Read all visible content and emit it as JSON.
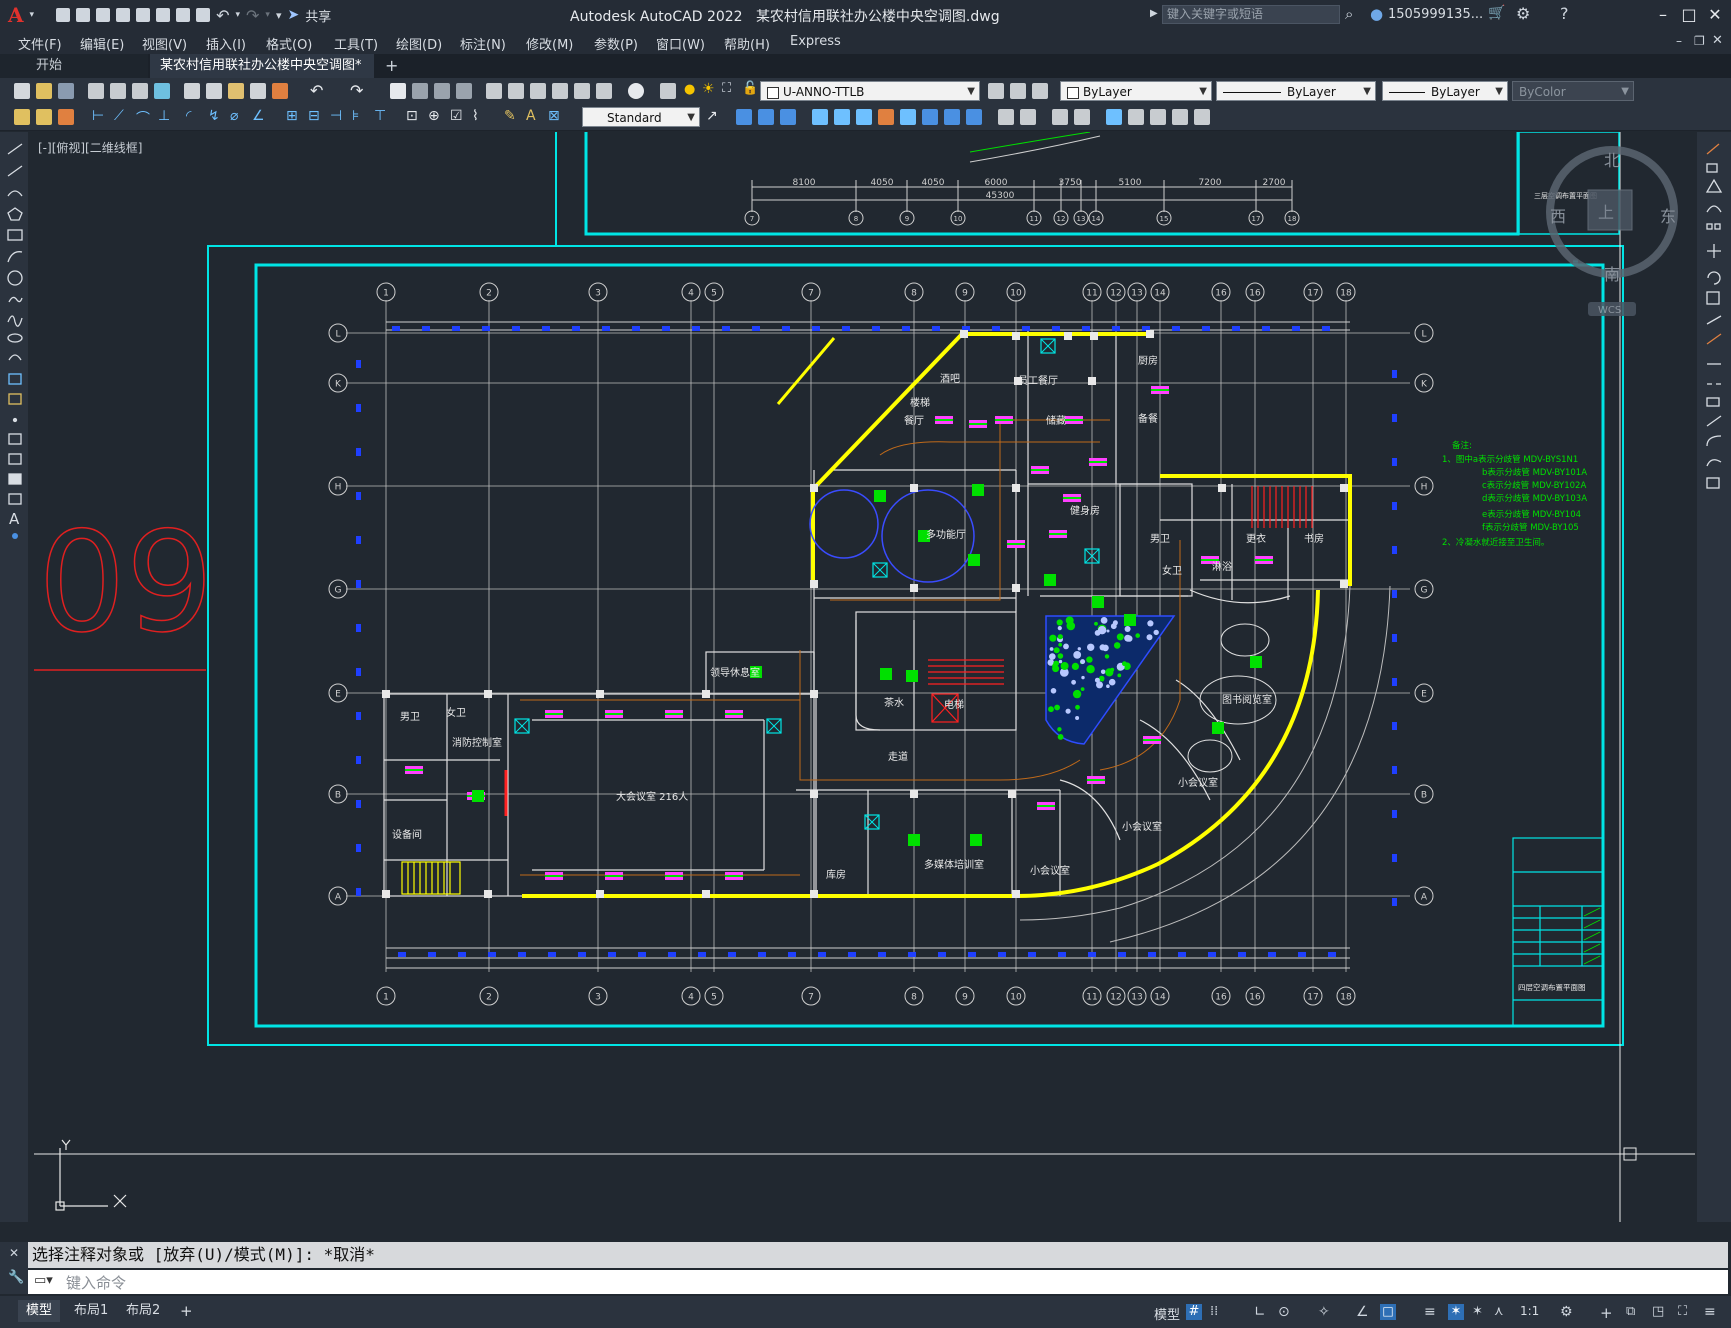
{
  "app": {
    "title": "Autodesk AutoCAD 2022",
    "document": "某农村信用联社办公楼中央空调图.dwg",
    "share_label": "共享",
    "search_placeholder": "键入关键字或短语",
    "user": "1505999135...",
    "logo": "A"
  },
  "menus": [
    "文件(F)",
    "编辑(E)",
    "视图(V)",
    "插入(I)",
    "格式(O)",
    "工具(T)",
    "绘图(D)",
    "标注(N)",
    "修改(M)",
    "参数(P)",
    "窗口(W)",
    "帮助(H)",
    "Express"
  ],
  "tabs": [
    {
      "label": "开始"
    },
    {
      "label": "某农村信用联社办公楼中央空调图*"
    }
  ],
  "toolbar": {
    "layer": "U-ANNO-TTLB",
    "color": "ByLayer",
    "linetype": "ByLayer",
    "lineweight": "ByLayer",
    "plotstyle": "ByColor",
    "textstyle": "Standard"
  },
  "viewport_label": "[-][俯视][二维线框]",
  "viewcube": {
    "north": "北",
    "east": "东",
    "south": "南",
    "west": "西",
    "top": "上",
    "wcs": "WCS"
  },
  "drawing": {
    "sheet_number": "09",
    "grid_top": [
      "1",
      "2",
      "3",
      "4",
      "5",
      "7",
      "8",
      "9",
      "10",
      "11",
      "12",
      "13",
      "14",
      "16",
      "16",
      "17",
      "18"
    ],
    "grid_bottom": [
      "1",
      "2",
      "3",
      "4",
      "5",
      "7",
      "8",
      "9",
      "10",
      "11",
      "12",
      "13",
      "14",
      "16",
      "16",
      "17",
      "18"
    ],
    "grid_rows": [
      "L",
      "K",
      "H",
      "G",
      "E",
      "B",
      "A"
    ],
    "rooms": [
      "员工餐厅",
      "厨房",
      "备餐",
      "酒吧",
      "餐厅",
      "多功能厅",
      "健身房",
      "男卫",
      "女卫",
      "淋浴",
      "书房",
      "更衣",
      "领导休息室",
      "茶水",
      "消防控制室",
      "大会议室 216人",
      "男卫",
      "女卫",
      "设备间",
      "走道",
      "库房",
      "多媒体培训室",
      "小会议室",
      "小会议室",
      "小会议室",
      "图书阅览室",
      "储藏",
      "楼梯",
      "电梯"
    ],
    "notes": {
      "heading": "备注:",
      "lines": [
        "1、图中a表示分歧管 MDV-BYS1N1",
        "b表示分歧管 MDV-BY101A",
        "c表示分歧管 MDV-BY102A",
        "d表示分歧管 MDV-BY103A",
        "e表示分歧管 MDV-BY104",
        "f表示分歧管 MDV-BY105",
        "2、冷凝水就近接至卫生间。"
      ]
    },
    "upper_plan_title": "三层空调布置平面图",
    "title_block_title": "四层空调布置平面图",
    "dims_upper": [
      "8100",
      "4050",
      "4050",
      "6000",
      "3750",
      "5100",
      "7200",
      "2700"
    ],
    "dims_upper_total": "45300"
  },
  "command": {
    "history": "选择注释对象或 [放弃(U)/模式(M)]: *取消*",
    "placeholder": "键入命令"
  },
  "status": {
    "layouts": [
      "模型",
      "布局1",
      "布局2"
    ],
    "add_layout": "+",
    "model_label": "模型",
    "scale": "1:1"
  },
  "colors": {
    "background": "#212830",
    "frame": "#00e5e5",
    "wall": "#ffff00",
    "grid_line": "#cfcfcf",
    "equipment": "#00e000",
    "unit": "#ff40ff",
    "air_outlet": "#1f3fff",
    "pipe": "#c06a1a",
    "red": "#ff2020"
  }
}
